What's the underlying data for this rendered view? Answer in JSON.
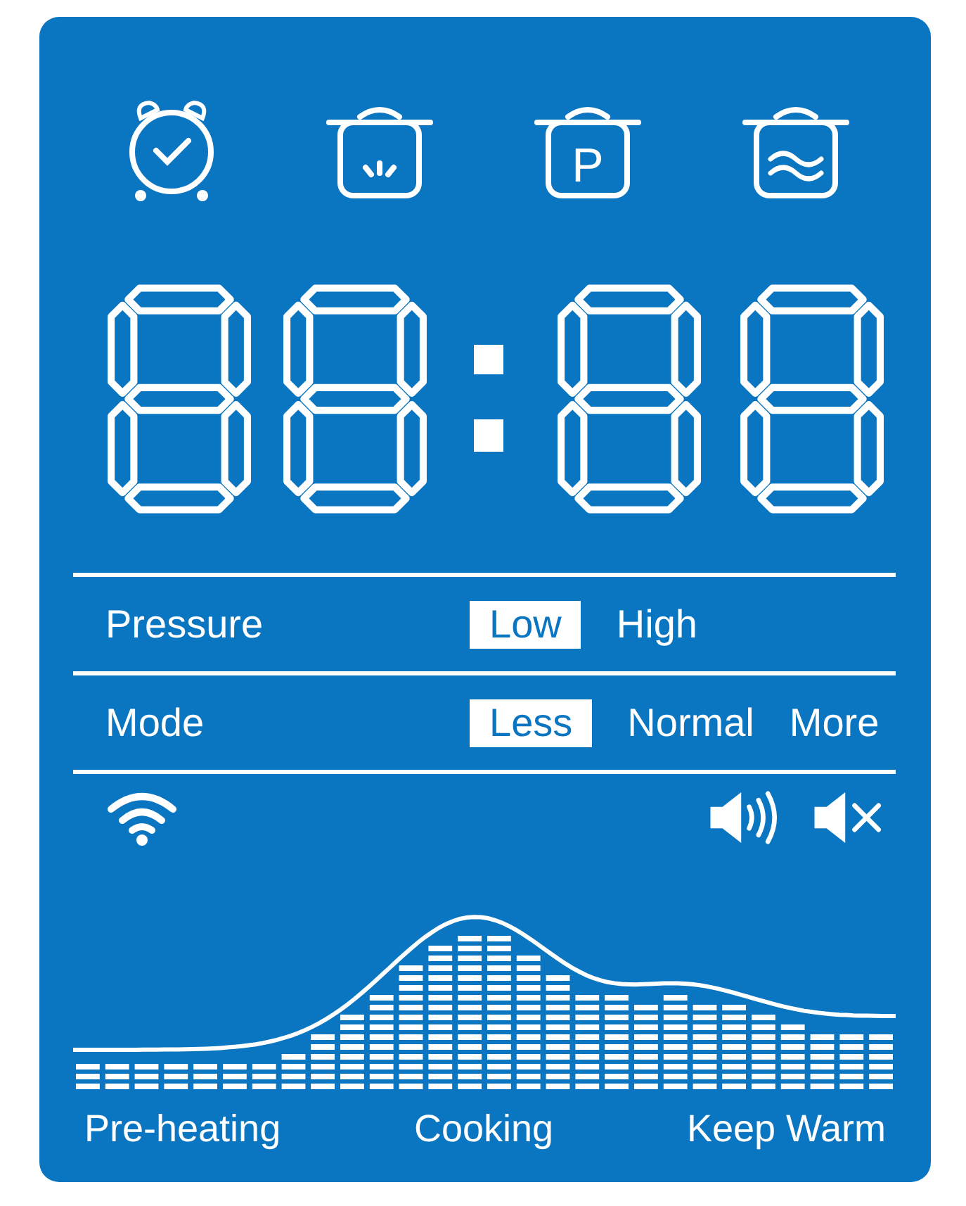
{
  "icons": [
    {
      "kind": "alarm"
    },
    {
      "kind": "pot-heat"
    },
    {
      "kind": "pot-letter",
      "letter": "P"
    },
    {
      "kind": "pot-steam"
    }
  ],
  "clock": {
    "digits": [
      {
        "segments": [
          true,
          true,
          true,
          true,
          true,
          true,
          true
        ]
      },
      {
        "segments": [
          true,
          true,
          true,
          true,
          true,
          true,
          true
        ]
      },
      {
        "segments": [
          true,
          true,
          true,
          true,
          true,
          true,
          true
        ]
      },
      {
        "segments": [
          true,
          true,
          true,
          true,
          true,
          true,
          true
        ]
      }
    ],
    "colon": true
  },
  "settings": [
    {
      "label": "Pressure",
      "options": [
        {
          "label": "Low",
          "selected": true
        },
        {
          "label": "High",
          "selected": false
        }
      ]
    },
    {
      "label": "Mode",
      "options": [
        {
          "label": "Less",
          "selected": true
        },
        {
          "label": "Normal",
          "selected": false
        },
        {
          "label": "More",
          "selected": false
        }
      ]
    }
  ],
  "indicators": {
    "wifi": true,
    "sound_on": true,
    "sound_muted": true
  },
  "stages": [
    "Pre-heating",
    "Cooking",
    "Keep Warm"
  ]
}
